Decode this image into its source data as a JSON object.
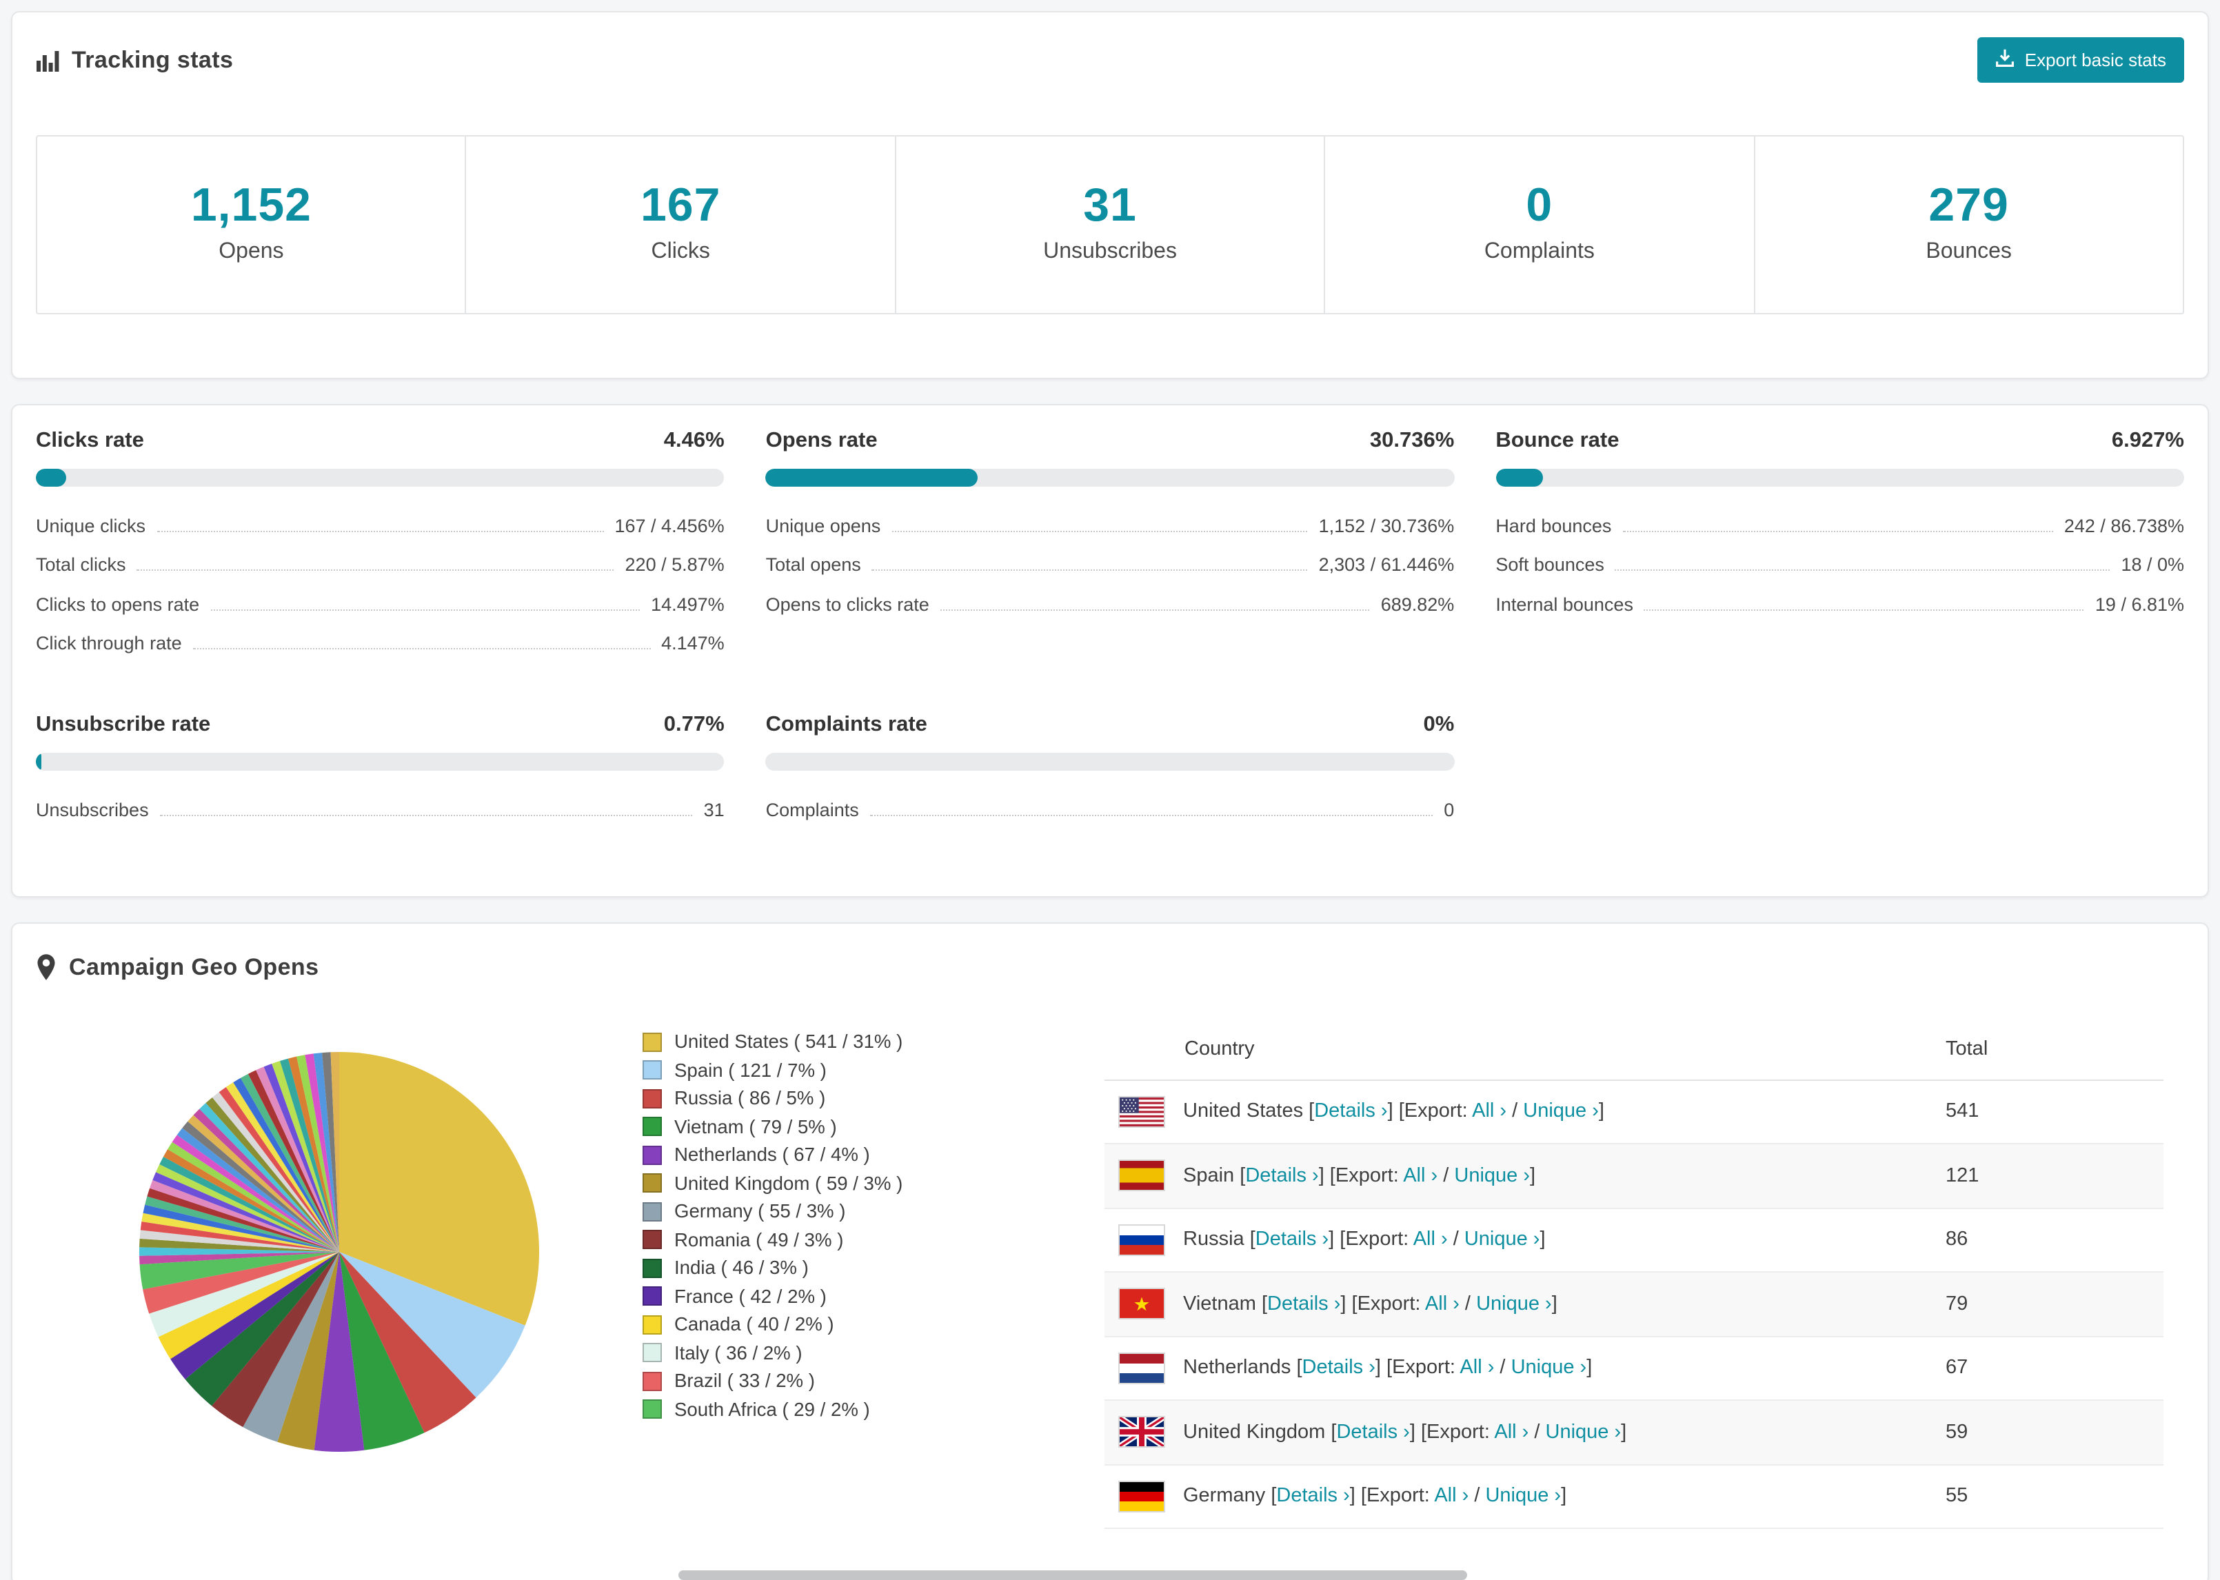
{
  "colors": {
    "accent": "#0e8fa1",
    "bar_track": "#e8eaec"
  },
  "tracking": {
    "title": "Tracking stats",
    "export_button": "Export basic stats"
  },
  "summary": [
    {
      "value": "1,152",
      "label": "Opens"
    },
    {
      "value": "167",
      "label": "Clicks"
    },
    {
      "value": "31",
      "label": "Unsubscribes"
    },
    {
      "value": "0",
      "label": "Complaints"
    },
    {
      "value": "279",
      "label": "Bounces"
    }
  ],
  "rates": [
    {
      "title": "Clicks rate",
      "percent_label": "4.46%",
      "percent": 4.46,
      "rows": [
        [
          "Unique clicks",
          "167 / 4.456%"
        ],
        [
          "Total clicks",
          "220 / 5.87%"
        ],
        [
          "Clicks to opens rate",
          "14.497%"
        ],
        [
          "Click through rate",
          "4.147%"
        ]
      ]
    },
    {
      "title": "Opens rate",
      "percent_label": "30.736%",
      "percent": 30.736,
      "rows": [
        [
          "Unique opens",
          "1,152 / 30.736%"
        ],
        [
          "Total opens",
          "2,303 / 61.446%"
        ],
        [
          "Opens to clicks rate",
          "689.82%"
        ]
      ]
    },
    {
      "title": "Bounce rate",
      "percent_label": "6.927%",
      "percent": 6.927,
      "rows": [
        [
          "Hard bounces",
          "242 / 86.738%"
        ],
        [
          "Soft bounces",
          "18 / 0%"
        ],
        [
          "Internal bounces",
          "19 / 6.81%"
        ]
      ]
    },
    {
      "title": "Unsubscribe rate",
      "percent_label": "0.77%",
      "percent": 0.77,
      "rows": [
        [
          "Unsubscribes",
          "31"
        ]
      ]
    },
    {
      "title": "Complaints rate",
      "percent_label": "0%",
      "percent": 0,
      "rows": [
        [
          "Complaints",
          "0"
        ]
      ]
    }
  ],
  "geo": {
    "title": "Campaign Geo Opens",
    "table": {
      "headers": [
        "Country",
        "Total"
      ],
      "details_label": "Details",
      "export_prefix": "Export:",
      "all_label": "All",
      "unique_label": "Unique",
      "rows": [
        {
          "country": "United States",
          "total": "541",
          "flag": "us"
        },
        {
          "country": "Spain",
          "total": "121",
          "flag": "es"
        },
        {
          "country": "Russia",
          "total": "86",
          "flag": "ru"
        },
        {
          "country": "Vietnam",
          "total": "79",
          "flag": "vn"
        },
        {
          "country": "Netherlands",
          "total": "67",
          "flag": "nl"
        },
        {
          "country": "United Kingdom",
          "total": "59",
          "flag": "gb"
        },
        {
          "country": "Germany",
          "total": "55",
          "flag": "de"
        }
      ]
    }
  },
  "chart_data": {
    "type": "pie",
    "title": "Campaign Geo Opens",
    "legend_position": "right",
    "slices": [
      {
        "label": "United States",
        "value": 541,
        "percent": 31,
        "color": "#e2c244"
      },
      {
        "label": "Spain",
        "value": 121,
        "percent": 7,
        "color": "#a6d3f3"
      },
      {
        "label": "Russia",
        "value": 86,
        "percent": 5,
        "color": "#ca4a45"
      },
      {
        "label": "Vietnam",
        "value": 79,
        "percent": 5,
        "color": "#2f9e41"
      },
      {
        "label": "Netherlands",
        "value": 67,
        "percent": 4,
        "color": "#8540bd"
      },
      {
        "label": "United Kingdom",
        "value": 59,
        "percent": 3,
        "color": "#b2952d"
      },
      {
        "label": "Germany",
        "value": 55,
        "percent": 3,
        "color": "#8fa3b0"
      },
      {
        "label": "Romania",
        "value": 49,
        "percent": 3,
        "color": "#8e3737"
      },
      {
        "label": "India",
        "value": 46,
        "percent": 3,
        "color": "#1f6f38"
      },
      {
        "label": "France",
        "value": 42,
        "percent": 2,
        "color": "#5a2ea6"
      },
      {
        "label": "Canada",
        "value": 40,
        "percent": 2,
        "color": "#f5d829"
      },
      {
        "label": "Italy",
        "value": 36,
        "percent": 2,
        "color": "#def2ec"
      },
      {
        "label": "Brazil",
        "value": 33,
        "percent": 2,
        "color": "#e86363"
      },
      {
        "label": "South Africa",
        "value": 29,
        "percent": 2,
        "color": "#57c15f"
      }
    ],
    "others": {
      "percent": 26,
      "slice_count": 38,
      "colors": [
        "#c24ca3",
        "#4cc3d9",
        "#8a8f34",
        "#d9d9d9",
        "#e05252",
        "#f0e04a",
        "#3a6fd8",
        "#52b88a",
        "#a83434",
        "#e08ac0",
        "#6d4fd8",
        "#b8e052",
        "#34a89e",
        "#d87f34",
        "#9ad852",
        "#d852c9",
        "#5297e0",
        "#7a7a7a",
        "#e0b452"
      ]
    }
  }
}
